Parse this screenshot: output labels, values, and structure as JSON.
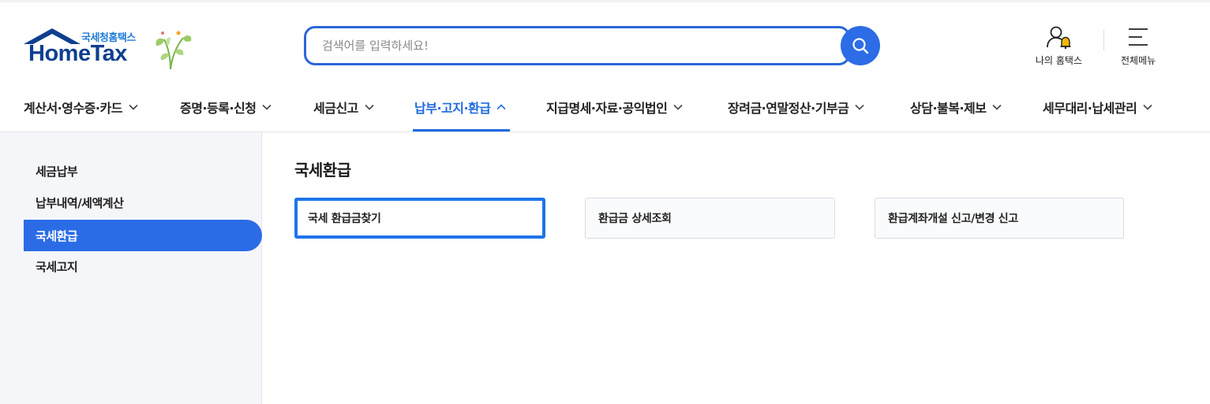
{
  "logo": {
    "tagline": "국세청홈택스",
    "wordmark": "HomeTax"
  },
  "search": {
    "placeholder": "검색어를 입력하세요!",
    "value": "",
    "button_icon": "search-icon"
  },
  "utilities": {
    "my_hometax": {
      "label": "나의 홈택스",
      "icon": "user-bell-icon"
    },
    "all_menu": {
      "label": "전체메뉴",
      "icon": "hamburger-menu-icon"
    }
  },
  "nav": {
    "items": [
      {
        "label": "계산서·영수증·카드",
        "expanded": false
      },
      {
        "label": "증명·등록·신청",
        "expanded": false
      },
      {
        "label": "세금신고",
        "expanded": false
      },
      {
        "label": "납부·고지·환급",
        "expanded": true
      },
      {
        "label": "지급명세·자료·공익법인",
        "expanded": false
      },
      {
        "label": "장려금·연말정산·기부금",
        "expanded": false
      },
      {
        "label": "상담·불복·제보",
        "expanded": false
      },
      {
        "label": "세무대리·납세관리",
        "expanded": false
      }
    ]
  },
  "sidebar": {
    "items": [
      {
        "label": "세금납부",
        "active": false
      },
      {
        "label": "납부내역/세액계산",
        "active": false
      },
      {
        "label": "국세환급",
        "active": true
      },
      {
        "label": "국세고지",
        "active": false
      }
    ]
  },
  "main": {
    "title": "국세환급",
    "cards": [
      {
        "label": "국세 환급금찾기",
        "focused": true
      },
      {
        "label": "환급금 상세조회",
        "focused": false
      },
      {
        "label": "환급계좌개설 신고/변경 신고",
        "focused": false
      }
    ]
  },
  "colors": {
    "accent": "#2b6ce6",
    "nav_active": "#1f6ae0",
    "logo": "#0d3f8f",
    "sidebar_bg": "#f5f6fa",
    "bell": "#f2b705"
  }
}
